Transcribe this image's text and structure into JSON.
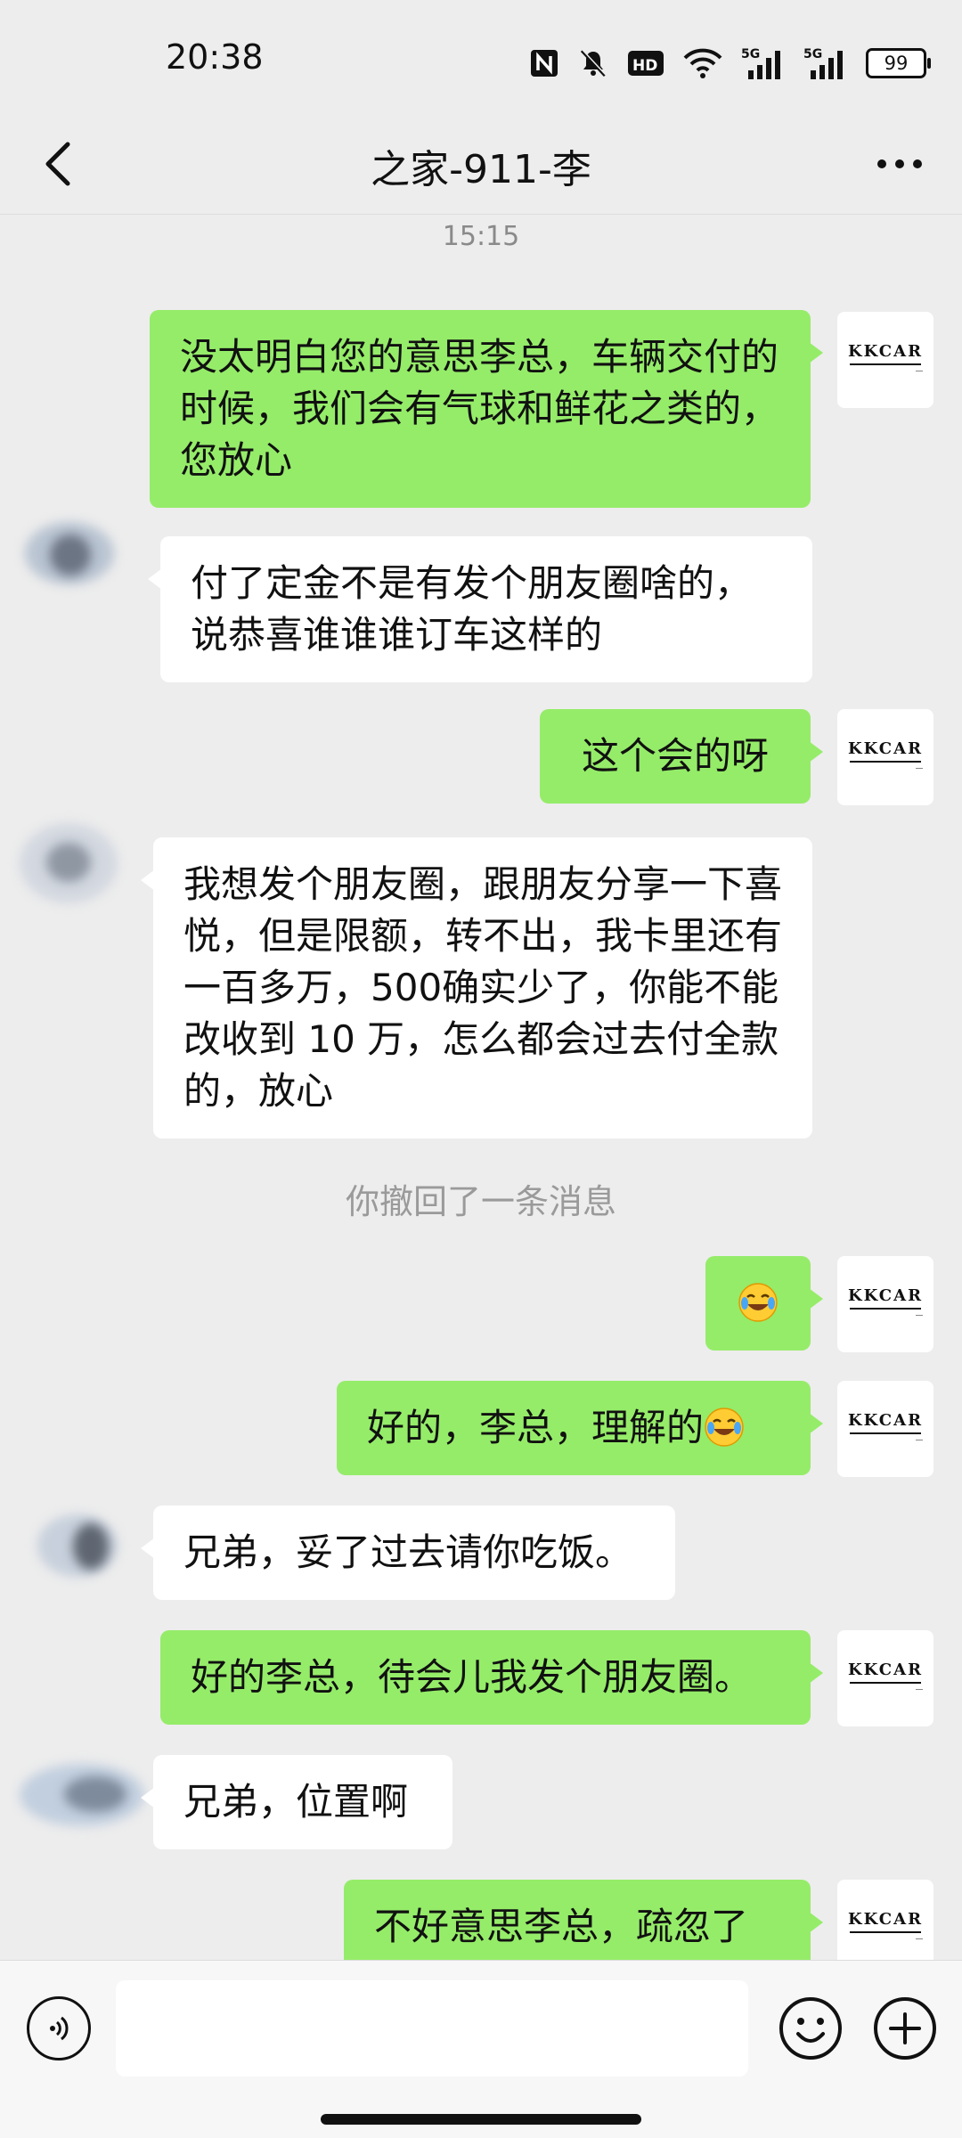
{
  "status_bar": {
    "time": "20:38",
    "icons": [
      "nfc-icon",
      "mute-icon",
      "hd-icon",
      "wifi-icon",
      "5g-signal-icon",
      "5g-signal-icon"
    ],
    "hd_label": "HD",
    "sig1_label": "5G",
    "sig2_label": "5G",
    "battery": "99"
  },
  "header": {
    "title": "之家-911-李"
  },
  "self_avatar_text": "KKCAR",
  "messages": [
    {
      "type": "time",
      "text": "15:15"
    },
    {
      "type": "msg",
      "from": "me",
      "text": "没太明白您的意思李总，车辆交付的时候，我们会有气球和鲜花之类的，您放心"
    },
    {
      "type": "msg",
      "from": "other",
      "text": "付了定金不是有发个朋友圈啥的，说恭喜谁谁谁订车这样的"
    },
    {
      "type": "msg",
      "from": "me",
      "text": "这个会的呀"
    },
    {
      "type": "msg",
      "from": "other",
      "text": "我想发个朋友圈，跟朋友分享一下喜悦，但是限额，转不出，我卡里还有一百多万，500确实少了，你能不能改收到 10 万，怎么都会过去付全款的，放心"
    },
    {
      "type": "system",
      "text": "你撤回了一条消息"
    },
    {
      "type": "msg",
      "from": "me",
      "text": "",
      "emoji": "laugh-cry-emoji"
    },
    {
      "type": "msg",
      "from": "me",
      "text": "好的，李总，理解的",
      "emoji": "laugh-cry-emoji"
    },
    {
      "type": "msg",
      "from": "other",
      "text": "兄弟，妥了过去请你吃饭。"
    },
    {
      "type": "msg",
      "from": "me",
      "text": "好的李总，待会儿我发个朋友圈。"
    },
    {
      "type": "msg",
      "from": "other",
      "text": "兄弟，位置啊"
    },
    {
      "type": "msg",
      "from": "me",
      "text": "不好意思李总，疏忽了"
    }
  ],
  "input_bar": {
    "placeholder": "",
    "icons": [
      "voice-icon",
      "emoji-icon",
      "plus-icon"
    ]
  }
}
